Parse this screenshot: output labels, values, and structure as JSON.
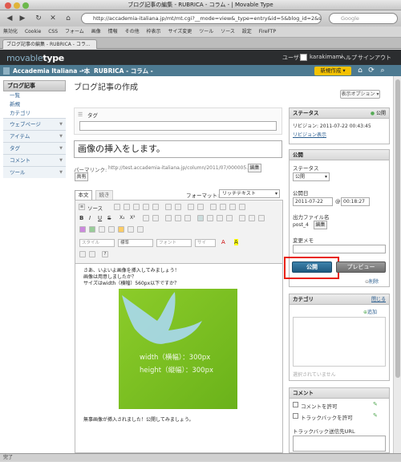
{
  "window": {
    "title": "ブログ記事の編集 - RUBRICA - コラム - | Movable Type"
  },
  "browser": {
    "url": "http://accademia-italiana.jp/mt/mt.cgi?__mode=view&_type=entry&id=5&blog_id=2&s",
    "search_placeholder": "Google",
    "bookmarks": [
      "無効化",
      "Cookie",
      "CSS",
      "フォーム",
      "画像",
      "情報",
      "その他",
      "枠表示",
      "サイズ変更",
      "ツール",
      "ソース",
      "設定",
      "FireFTP"
    ],
    "tab_label": "ブログ記事の編集 - RUBRICA - コラ..."
  },
  "mt": {
    "logo": "movable",
    "logo2": "type",
    "user_label": "ユーザー:",
    "user_name": "karakimami",
    "help": "ヘルプ",
    "signout": "サインアウト",
    "blog_site": "Accademia Italiana - 本",
    "blog_name": "RUBRICA - コラム -",
    "new_button": "新規作成"
  },
  "sidebar": {
    "header": "ブログ記事",
    "items": [
      "一覧",
      "新規",
      "カテゴリ"
    ],
    "sections": [
      "ウェブページ",
      "アイテム",
      "タグ",
      "コメント",
      "ツール"
    ]
  },
  "main": {
    "page_title": "ブログ記事の作成",
    "display_options": "表示オプション",
    "tag_label": "タグ",
    "entry_title": "画像の挿入をします。",
    "permalink_label": "パーマリンク:",
    "permalink_url": "http://test.accademia-italiana.jp/column/2011/07/000005.html",
    "edit_btn": "編集",
    "share_btn": "共有",
    "tab_body": "本文",
    "tab_more": "続き",
    "format_label": "フォーマット:",
    "format_value": "リッチテキスト",
    "source_btn": "ソース",
    "style_sel": "スタイル",
    "normal_sel": "標準",
    "font_sel": "フォント",
    "size_sel": "サイ",
    "body_lines": [
      "さあ、いよいよ画像を挿入してみましょう！",
      "画像は用意しましたか？",
      "サイズはwidth（横幅）560px以下ですか？"
    ],
    "image_text1": "width（横幅）：300px",
    "image_text2": "height（縦幅）：300px",
    "after_image": "無事画像が挿入されました！公開してみましょう。"
  },
  "right": {
    "status_title": "ステータス",
    "status_public": "公開",
    "revision": "リビジョン: 2011-07-22 00:43:45",
    "revision_link": "リビジョン表示",
    "publish_title": "公開",
    "status_label": "ステータス",
    "status_value": "公開",
    "date_label": "公開日",
    "date_value": "2011-07-22",
    "time_value": "00:18:27",
    "filename_label": "出力ファイル名",
    "filename_value": "post_4",
    "filename_edit": "編集",
    "memo_label": "変更メモ",
    "publish_btn": "公開",
    "preview_btn": "プレビュー",
    "delete_link": "削除",
    "category_title": "カテゴリ",
    "category_close": "閉じる",
    "category_add": "追加",
    "category_none": "選択されていません",
    "comment_title": "コメント",
    "allow_comments": "コメントを許可",
    "allow_trackbacks": "トラックバックを許可",
    "trackback_label": "トラックバック送信先URL"
  },
  "statusbar": {
    "text": "完了"
  },
  "colors": {
    "header": "#2b2d2f",
    "blogbar": "#4d7a91",
    "new_button": "#f5c200",
    "publish": "#2e6a8e",
    "highlight": "#e8210d",
    "image_green": "#7cc020"
  }
}
